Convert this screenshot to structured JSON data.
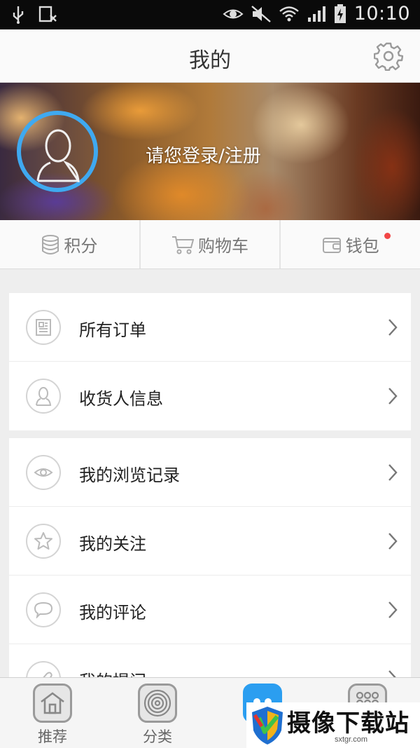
{
  "status_bar": {
    "time": "10:10",
    "icons": [
      "usb-icon",
      "sim-off-icon",
      "eye-icon",
      "mute-icon",
      "wifi-icon",
      "signal-icon",
      "battery-charging-icon"
    ]
  },
  "header": {
    "title": "我的",
    "settings_icon": "gear-icon"
  },
  "profile": {
    "login_text": "请您登录/注册",
    "avatar_ring_color": "#3fa9f0"
  },
  "quick_links": [
    {
      "label": "积分",
      "icon": "database-icon"
    },
    {
      "label": "购物车",
      "icon": "cart-icon"
    },
    {
      "label": "钱包",
      "icon": "wallet-icon",
      "badge_color": "#f24646"
    }
  ],
  "menu_group_1": [
    {
      "label": "所有订单",
      "icon": "document-icon"
    },
    {
      "label": "收货人信息",
      "icon": "person-icon"
    }
  ],
  "menu_group_2": [
    {
      "label": "我的浏览记录",
      "icon": "eye-icon"
    },
    {
      "label": "我的关注",
      "icon": "star-icon"
    },
    {
      "label": "我的评论",
      "icon": "comment-icon"
    },
    {
      "label": "我的提问",
      "icon": "pin-icon"
    }
  ],
  "tab_bar": [
    {
      "label": "推荐",
      "icon": "home-icon"
    },
    {
      "label": "分类",
      "icon": "target-icon"
    },
    {
      "label": "",
      "icon": "me-icon",
      "active": true
    },
    {
      "label": "",
      "icon": "grid-icon"
    }
  ],
  "watermark": {
    "text": "摄像下载站",
    "sub": "sxtgr.com"
  },
  "colors": {
    "accent": "#2b9ef0",
    "badge": "#f24646"
  }
}
